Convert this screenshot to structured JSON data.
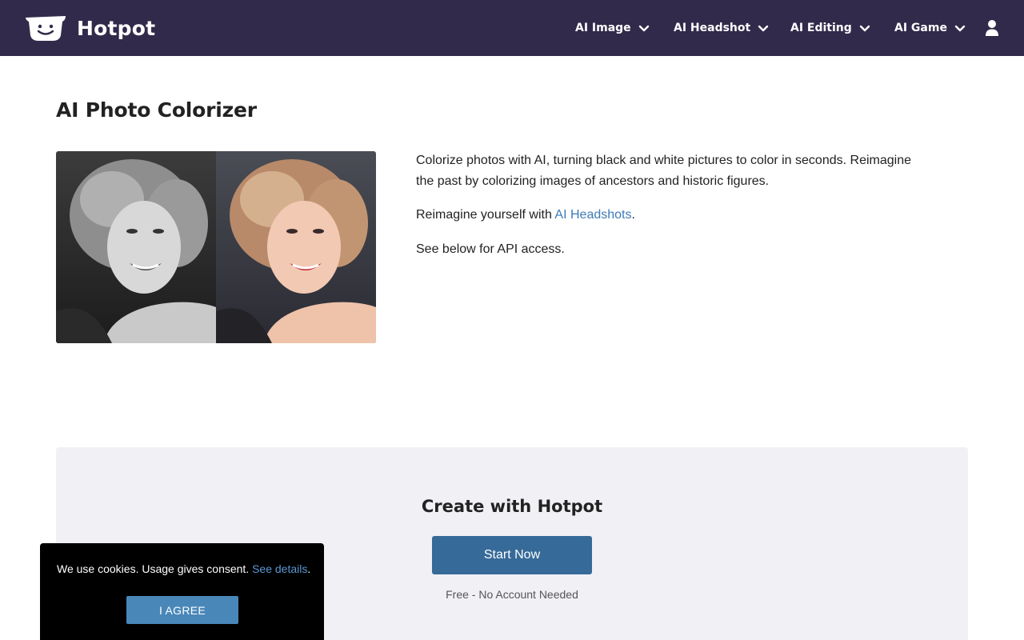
{
  "brand": {
    "name": "Hotpot",
    "logo_icon": "smiling-pot-icon"
  },
  "nav": {
    "items": [
      {
        "label": "AI Image",
        "icon": "chevron-down-icon"
      },
      {
        "label": "AI Headshot",
        "icon": "chevron-down-icon"
      },
      {
        "label": "AI Editing",
        "icon": "chevron-down-icon"
      },
      {
        "label": "AI Game",
        "icon": "chevron-down-icon"
      }
    ],
    "account_icon": "user-icon"
  },
  "hero": {
    "title": "AI Photo Colorizer",
    "image_description_icon": "before-after-colorized-portrait",
    "paragraph_1": "Colorize photos with AI, turning black and white pictures to color in seconds. Reimagine the past by colorizing images of ancestors and historic figures.",
    "paragraph_2_prefix": "Reimagine yourself with ",
    "paragraph_2_link": "AI Headshots",
    "paragraph_2_suffix": ".",
    "paragraph_3": "See below for API access."
  },
  "create": {
    "title": "Create with Hotpot",
    "button_label": "Start Now",
    "subtitle": "Free - No Account Needed"
  },
  "cookie": {
    "text": "We use cookies. Usage gives consent. ",
    "link": "See details",
    "suffix": ".",
    "button_label": "I AGREE"
  },
  "colors": {
    "nav_bg": "#322a4b",
    "primary_button": "#366a98",
    "link": "#3d7bb6",
    "panel_bg": "#f1f0f5",
    "cookie_bg": "#000000",
    "cookie_button": "#4a87b9"
  }
}
